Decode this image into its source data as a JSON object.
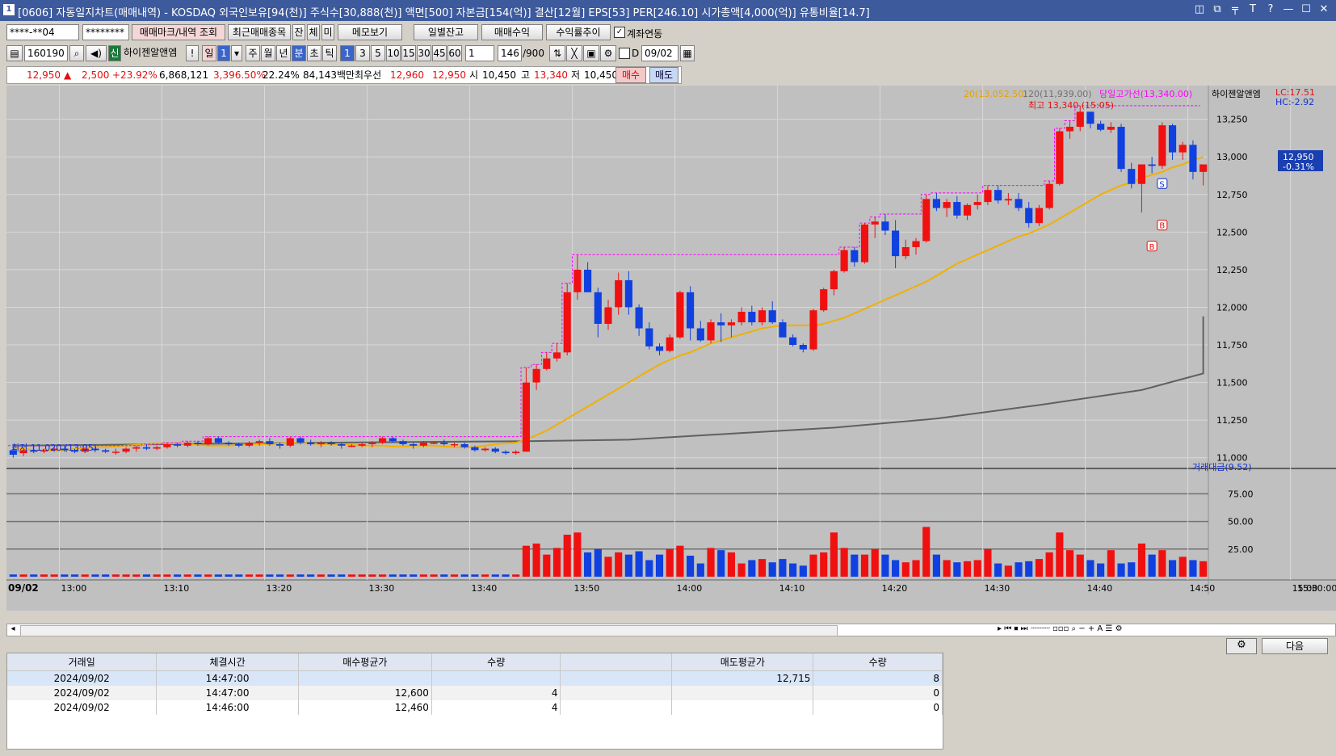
{
  "window": {
    "title": "[0606] 자동일지차트(매매내역) - KOSDAQ 외국인보유[94(천)] 주식수[30,888(천)] 액면[500] 자본금[154(억)] 결산[12월] EPS[53] PER[246.10] 시가총액[4,000(억)] 유통비율[14.7]",
    "app_icon": "1",
    "buttons": [
      "◫",
      "⧉",
      "╤",
      "T",
      "?",
      "—",
      "☐",
      "✕"
    ]
  },
  "toolbar1": {
    "account": "****-**04",
    "password": "********",
    "btn_trade_mark": "매매마크/내역 조회",
    "btn_recent": "최근매매종목",
    "btn_jan": "잔",
    "btn_che": "체",
    "btn_mi": "미",
    "btn_memo": "메모보기",
    "btn_daily": "일별잔고",
    "btn_profit": "매매수익",
    "btn_return": "수익률추이",
    "check_account_link": "계좌연동"
  },
  "toolbar2": {
    "code": "160190",
    "sin": "신",
    "stock_name": "하이젠알앤엠",
    "excl": "!",
    "period_il": "일",
    "period_num": "1",
    "periods": [
      "주",
      "월",
      "년",
      "분",
      "초",
      "틱"
    ],
    "minutes": [
      "1",
      "3",
      "5",
      "10",
      "15",
      "30",
      "45",
      "60"
    ],
    "interval": "1",
    "count": "146",
    "count_total": "/900",
    "d_label": "D",
    "date": "09/02"
  },
  "quote": {
    "price": "12,950",
    "arrow": "▲",
    "change": "2,500",
    "change_pct": "+23.92%",
    "volume": "6,868,121",
    "vol_pct": "3,396.50%",
    "turnover": "22.24%",
    "amount": "84,143백만",
    "best_label": "최우선",
    "best_ask": "12,960",
    "best_bid": "12,950",
    "open_label": "시",
    "open": "10,450",
    "high_label": "고",
    "high": "13,340",
    "low_label": "저",
    "low": "10,450",
    "buy": "매수",
    "sell": "매도"
  },
  "chart_legend": {
    "ma20": "20(13,052.50)",
    "ma120": "120(11,939.00)",
    "prev_high": "당일고가선(13,340.00)",
    "name": "하이젠알앤엠",
    "lc": "LC:17.51",
    "hc": "HC:-2.92",
    "high_label": "최고 13,340 (15:05)",
    "low_label": "최저 11,020 (13:05)",
    "current_price": "12,950",
    "current_pct": "-0.31%",
    "vol_title": "거래대금(9.52)",
    "date_label": "09/02",
    "last_time": "15:30:00"
  },
  "chart_data": {
    "type": "candlestick",
    "price_axis": [
      "13,250",
      "13,000",
      "12,750",
      "12,500",
      "12,250",
      "12,000",
      "11,750",
      "11,500",
      "11,250",
      "11,000"
    ],
    "vol_axis": [
      "75.00",
      "50.00",
      "25.00"
    ],
    "time_axis": [
      "13:00",
      "13:10",
      "13:20",
      "13:30",
      "13:40",
      "13:50",
      "14:00",
      "14:10",
      "14:20",
      "14:30",
      "14:40",
      "14:50",
      "15:00",
      "15:10"
    ],
    "ylim": [
      10950,
      13420
    ],
    "candles": [
      [
        11050,
        11080,
        11000,
        11020
      ],
      [
        11030,
        11060,
        11010,
        11050
      ],
      [
        11050,
        11080,
        11030,
        11040
      ],
      [
        11050,
        11060,
        11030,
        11050
      ],
      [
        11050,
        11070,
        11040,
        11060
      ],
      [
        11060,
        11080,
        11040,
        11050
      ],
      [
        11050,
        11060,
        11030,
        11040
      ],
      [
        11040,
        11070,
        11030,
        11060
      ],
      [
        11060,
        11070,
        11040,
        11050
      ],
      [
        11050,
        11060,
        11030,
        11040
      ],
      [
        11040,
        11060,
        11020,
        11040
      ],
      [
        11040,
        11070,
        11030,
        11060
      ],
      [
        11060,
        11080,
        11040,
        11070
      ],
      [
        11070,
        11090,
        11050,
        11060
      ],
      [
        11060,
        11080,
        11050,
        11070
      ],
      [
        11070,
        11100,
        11060,
        11090
      ],
      [
        11090,
        11100,
        11070,
        11080
      ],
      [
        11080,
        11110,
        11070,
        11100
      ],
      [
        11100,
        11110,
        11080,
        11090
      ],
      [
        11090,
        11140,
        11080,
        11130
      ],
      [
        11130,
        11140,
        11090,
        11100
      ],
      [
        11100,
        11110,
        11080,
        11090
      ],
      [
        11090,
        11100,
        11070,
        11080
      ],
      [
        11080,
        11110,
        11070,
        11100
      ],
      [
        11100,
        11120,
        11080,
        11110
      ],
      [
        11110,
        11130,
        11080,
        11090
      ],
      [
        11090,
        11100,
        11060,
        11080
      ],
      [
        11080,
        11140,
        11070,
        11130
      ],
      [
        11130,
        11140,
        11090,
        11100
      ],
      [
        11100,
        11120,
        11080,
        11090
      ],
      [
        11090,
        11110,
        11070,
        11100
      ],
      [
        11100,
        11110,
        11080,
        11090
      ],
      [
        11090,
        11100,
        11060,
        11080
      ],
      [
        11080,
        11090,
        11070,
        11080
      ],
      [
        11080,
        11100,
        11070,
        11090
      ],
      [
        11090,
        11110,
        11070,
        11100
      ],
      [
        11100,
        11140,
        11090,
        11130
      ],
      [
        11130,
        11140,
        11100,
        11110
      ],
      [
        11110,
        11120,
        11080,
        11090
      ],
      [
        11090,
        11100,
        11060,
        11080
      ],
      [
        11080,
        11110,
        11070,
        11100
      ],
      [
        11100,
        11110,
        11090,
        11100
      ],
      [
        11100,
        11120,
        11080,
        11090
      ],
      [
        11090,
        11100,
        11070,
        11090
      ],
      [
        11090,
        11100,
        11060,
        11070
      ],
      [
        11070,
        11080,
        11040,
        11050
      ],
      [
        11050,
        11070,
        11040,
        11060
      ],
      [
        11060,
        11070,
        11030,
        11040
      ],
      [
        11040,
        11050,
        11020,
        11030
      ],
      [
        11030,
        11050,
        11020,
        11040
      ],
      [
        11040,
        11600,
        11040,
        11500
      ],
      [
        11500,
        11620,
        11450,
        11590
      ],
      [
        11590,
        11700,
        11580,
        11660
      ],
      [
        11660,
        11760,
        11640,
        11700
      ],
      [
        11700,
        12160,
        11680,
        12100
      ],
      [
        12100,
        12350,
        12050,
        12250
      ],
      [
        12250,
        12300,
        12100,
        12100
      ],
      [
        12100,
        12130,
        11800,
        11890
      ],
      [
        11890,
        12050,
        11850,
        12000
      ],
      [
        12000,
        12230,
        11950,
        12180
      ],
      [
        12180,
        12240,
        11950,
        12000
      ],
      [
        12000,
        12020,
        11810,
        11860
      ],
      [
        11860,
        11900,
        11720,
        11740
      ],
      [
        11740,
        11760,
        11680,
        11710
      ],
      [
        11710,
        11820,
        11700,
        11800
      ],
      [
        11800,
        12110,
        11790,
        12100
      ],
      [
        12100,
        12140,
        11780,
        11860
      ],
      [
        11860,
        11910,
        11770,
        11780
      ],
      [
        11780,
        11920,
        11760,
        11900
      ],
      [
        11900,
        11960,
        11770,
        11880
      ],
      [
        11880,
        11920,
        11800,
        11900
      ],
      [
        11900,
        12000,
        11880,
        11970
      ],
      [
        11970,
        12010,
        11880,
        11900
      ],
      [
        11900,
        12000,
        11880,
        11980
      ],
      [
        11980,
        12040,
        11890,
        11900
      ],
      [
        11900,
        11920,
        11800,
        11800
      ],
      [
        11800,
        11820,
        11740,
        11750
      ],
      [
        11750,
        11760,
        11700,
        11720
      ],
      [
        11720,
        11990,
        11710,
        11980
      ],
      [
        11980,
        12130,
        11970,
        12120
      ],
      [
        12120,
        12250,
        12080,
        12240
      ],
      [
        12240,
        12400,
        12230,
        12380
      ],
      [
        12380,
        12400,
        12270,
        12300
      ],
      [
        12300,
        12560,
        12290,
        12550
      ],
      [
        12550,
        12600,
        12460,
        12570
      ],
      [
        12570,
        12620,
        12480,
        12510
      ],
      [
        12510,
        12580,
        12260,
        12340
      ],
      [
        12340,
        12450,
        12320,
        12400
      ],
      [
        12400,
        12460,
        12350,
        12440
      ],
      [
        12440,
        12750,
        12430,
        12720
      ],
      [
        12720,
        12760,
        12640,
        12660
      ],
      [
        12660,
        12720,
        12600,
        12700
      ],
      [
        12700,
        12740,
        12590,
        12610
      ],
      [
        12610,
        12690,
        12580,
        12680
      ],
      [
        12680,
        12750,
        12650,
        12700
      ],
      [
        12700,
        12810,
        12680,
        12780
      ],
      [
        12780,
        12810,
        12690,
        12710
      ],
      [
        12710,
        12760,
        12680,
        12720
      ],
      [
        12720,
        12760,
        12640,
        12660
      ],
      [
        12660,
        12700,
        12530,
        12560
      ],
      [
        12560,
        12680,
        12540,
        12660
      ],
      [
        12660,
        12840,
        12650,
        12820
      ],
      [
        12820,
        13190,
        12810,
        13170
      ],
      [
        13170,
        13240,
        13120,
        13200
      ],
      [
        13200,
        13340,
        13170,
        13300
      ],
      [
        13300,
        13300,
        13190,
        13220
      ],
      [
        13220,
        13240,
        13170,
        13180
      ],
      [
        13180,
        13230,
        13160,
        13200
      ],
      [
        13200,
        13220,
        12900,
        12920
      ],
      [
        12920,
        12960,
        12790,
        12820
      ],
      [
        12820,
        12950,
        12630,
        12950
      ],
      [
        12950,
        13000,
        12890,
        12940
      ],
      [
        12940,
        13230,
        12920,
        13210
      ],
      [
        13210,
        13220,
        12980,
        13030
      ],
      [
        13030,
        13100,
        12980,
        13080
      ],
      [
        13080,
        13110,
        12850,
        12900
      ],
      [
        12900,
        12940,
        12810,
        12950
      ]
    ],
    "ma20": [
      11070,
      11060,
      11050,
      11050,
      11045,
      11050,
      11060,
      11065,
      11070,
      11070,
      11075,
      11080,
      11085,
      11090,
      11095,
      11095,
      11095,
      11090,
      11085,
      11080,
      11080,
      11080,
      11085,
      11090,
      11090,
      11090,
      11095,
      11100,
      11100,
      11095,
      11090,
      11090,
      11090,
      11085,
      11080,
      11080,
      11080,
      11075,
      11075,
      11080,
      11080,
      11080,
      11075,
      11070,
      11070,
      11070,
      11080,
      11090,
      11095,
      11100,
      11120,
      11150,
      11180,
      11220,
      11260,
      11300,
      11340,
      11380,
      11420,
      11460,
      11500,
      11540,
      11580,
      11620,
      11650,
      11680,
      11700,
      11730,
      11760,
      11780,
      11800,
      11820,
      11840,
      11860,
      11870,
      11880,
      11880,
      11880,
      11880,
      11890,
      11910,
      11930,
      11960,
      11990,
      12020,
      12050,
      12080,
      12110,
      12140,
      12170,
      12210,
      12250,
      12290,
      12320,
      12350,
      12380,
      12410,
      12440,
      12470,
      12490,
      12520,
      12550,
      12590,
      12630,
      12670,
      12710,
      12750,
      12780,
      12810,
      12830,
      12860,
      12880,
      12900,
      12930,
      12950,
      12980,
      13000
    ],
    "ma120_points": [
      [
        0,
        11080
      ],
      [
        30,
        11100
      ],
      [
        50,
        11110
      ],
      [
        60,
        11120
      ],
      [
        70,
        11160
      ],
      [
        80,
        11200
      ],
      [
        90,
        11260
      ],
      [
        100,
        11350
      ],
      [
        110,
        11450
      ],
      [
        120,
        11560
      ],
      [
        130,
        11680
      ],
      [
        140,
        11840
      ],
      [
        146,
        11940
      ]
    ],
    "prev_high_line": 13340,
    "volume": [
      2,
      2,
      2,
      2,
      2,
      2,
      2,
      2,
      2,
      2,
      2,
      2,
      2,
      2,
      2,
      2,
      2,
      2,
      2,
      2,
      2,
      2,
      2,
      2,
      2,
      2,
      2,
      2,
      2,
      2,
      2,
      2,
      2,
      2,
      2,
      2,
      2,
      2,
      2,
      2,
      2,
      2,
      2,
      2,
      2,
      2,
      2,
      2,
      2,
      2,
      28,
      30,
      20,
      26,
      38,
      40,
      22,
      25,
      18,
      22,
      20,
      23,
      15,
      20,
      25,
      28,
      19,
      12,
      26,
      24,
      22,
      12,
      15,
      16,
      13,
      16,
      12,
      10,
      20,
      22,
      40,
      26,
      20,
      20,
      25,
      20,
      15,
      13,
      15,
      45,
      20,
      15,
      13,
      14,
      15,
      25,
      12,
      10,
      13,
      14,
      16,
      22,
      40,
      24,
      20,
      15,
      12,
      24,
      12,
      13,
      30,
      20,
      24,
      15,
      18,
      15,
      14
    ],
    "trades": [
      {
        "t": "14:46",
        "type": "B",
        "price": 12460
      },
      {
        "t": "14:47",
        "type": "B",
        "price": 12600
      },
      {
        "t": "14:47",
        "type": "S",
        "price": 12715
      }
    ]
  },
  "grid": {
    "headers": [
      "거래일",
      "체결시간",
      "매수평균가",
      "수량",
      "",
      "매도평균가",
      "수량"
    ],
    "rows": [
      [
        "2024/09/02",
        "14:47:00",
        "",
        "",
        "",
        "12,715",
        "8"
      ],
      [
        "2024/09/02",
        "14:47:00",
        "12,600",
        "4",
        "",
        "",
        "0"
      ],
      [
        "2024/09/02",
        "14:46:00",
        "12,460",
        "4",
        "",
        "",
        "0"
      ]
    ],
    "next_btn": "다음"
  }
}
